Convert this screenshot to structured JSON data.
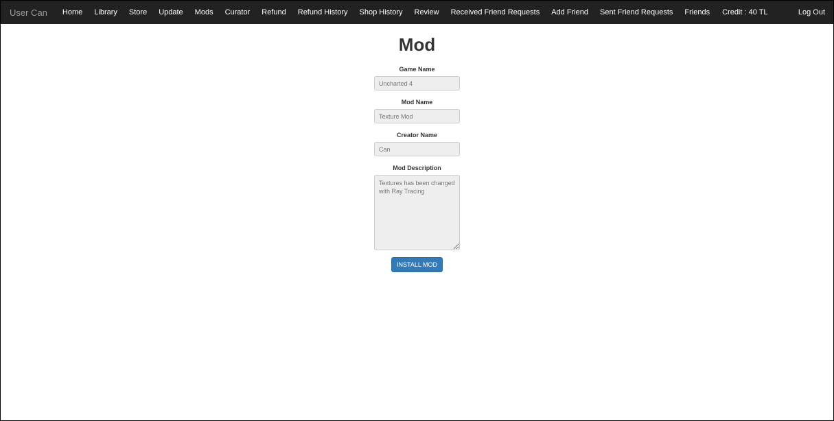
{
  "navbar": {
    "brand": "User Can",
    "items": [
      {
        "label": "Home"
      },
      {
        "label": "Library"
      },
      {
        "label": "Store"
      },
      {
        "label": "Update"
      },
      {
        "label": "Mods"
      },
      {
        "label": "Curator"
      },
      {
        "label": "Refund"
      },
      {
        "label": "Refund History"
      },
      {
        "label": "Shop History"
      },
      {
        "label": "Review"
      },
      {
        "label": "Received Friend Requests"
      },
      {
        "label": "Add Friend"
      },
      {
        "label": "Sent Friend Requests"
      },
      {
        "label": "Friends"
      }
    ],
    "credit": "Credit : 40 TL",
    "logout": "Log Out"
  },
  "page": {
    "title": "Mod"
  },
  "form": {
    "game_name": {
      "label": "Game Name",
      "value": "Uncharted 4"
    },
    "mod_name": {
      "label": "Mod Name",
      "value": "Texture Mod"
    },
    "creator_name": {
      "label": "Creator Name",
      "value": "Can"
    },
    "mod_description": {
      "label": "Mod Description",
      "value": "Textures has been changed with Ray Tracing"
    },
    "submit_label": "INSTALL MOD"
  },
  "colors": {
    "navbar_bg": "#222222",
    "brand": "#9d9d9d",
    "primary": "#337ab7"
  }
}
